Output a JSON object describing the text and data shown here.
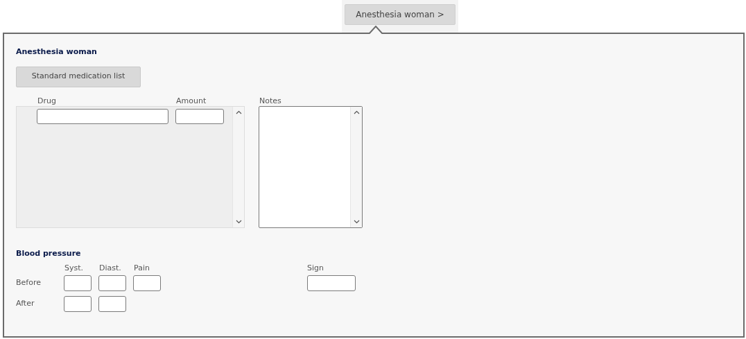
{
  "popup_button": {
    "label": "Anesthesia woman >"
  },
  "popup": {
    "title": "Anesthesia woman",
    "standard_list_button": "Standard medication list",
    "medication": {
      "columns": [
        "Drug",
        "Amount"
      ]
    },
    "notes": {
      "label": "Notes"
    },
    "blood_pressure": {
      "title": "Blood pressure",
      "columns": [
        "Syst.",
        "Diast.",
        "Pain"
      ],
      "rows": [
        {
          "label": "Before",
          "fields": [
            {
              "kind": "input"
            },
            {
              "kind": "input"
            },
            {
              "kind": "input"
            }
          ]
        },
        {
          "label": "After",
          "fields": [
            {
              "kind": "input"
            },
            {
              "kind": "input"
            }
          ]
        }
      ],
      "sign_label": "Sign"
    }
  }
}
